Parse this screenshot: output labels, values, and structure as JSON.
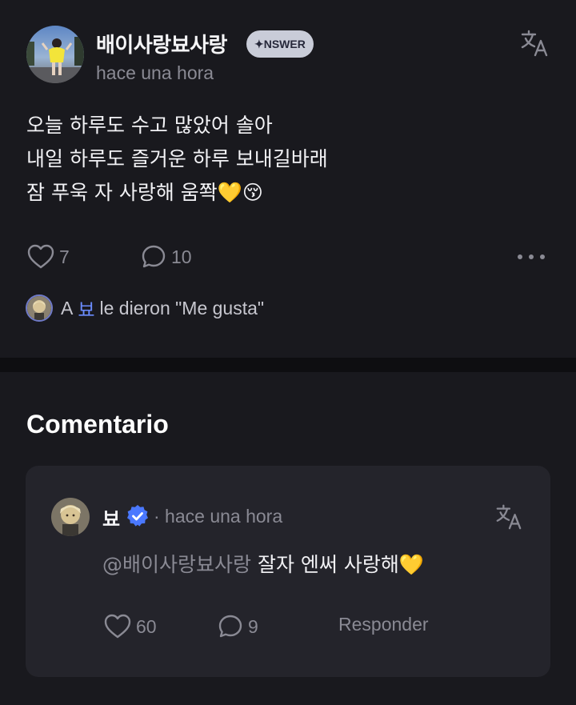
{
  "post": {
    "author": "배이사랑뵤사랑",
    "badge": "✦NSWER",
    "timestamp": "hace una hora",
    "lines": [
      "오늘 하루도 수고 많았어 솔아",
      "내일 하루도 즐거운 하루 보내길바래",
      "잠 푸욱 자 사랑해 움쫙💛😚"
    ],
    "likes": "7",
    "comments": "10",
    "liked_by": {
      "prefix": "A",
      "name": "뵤",
      "suffix": "le dieron \"Me gusta\""
    },
    "icons": {
      "translate": "translate-icon",
      "like": "heart-icon",
      "comment": "comment-bubble-icon",
      "more": "more-dots-icon"
    }
  },
  "comments_section": {
    "title": "Comentario",
    "items": [
      {
        "author": "뵤",
        "verified": true,
        "meta": "· hace una hora",
        "mention": "@배이사랑뵤사랑",
        "text": " 잘자 엔써 사랑해💛",
        "likes": "60",
        "replies": "9",
        "reply_label": "Responder"
      }
    ]
  },
  "colors": {
    "background": "#19191e",
    "card": "#24242b",
    "muted": "#8a8a94",
    "accent": "#6b8cff",
    "verified": "#4a78ff"
  }
}
